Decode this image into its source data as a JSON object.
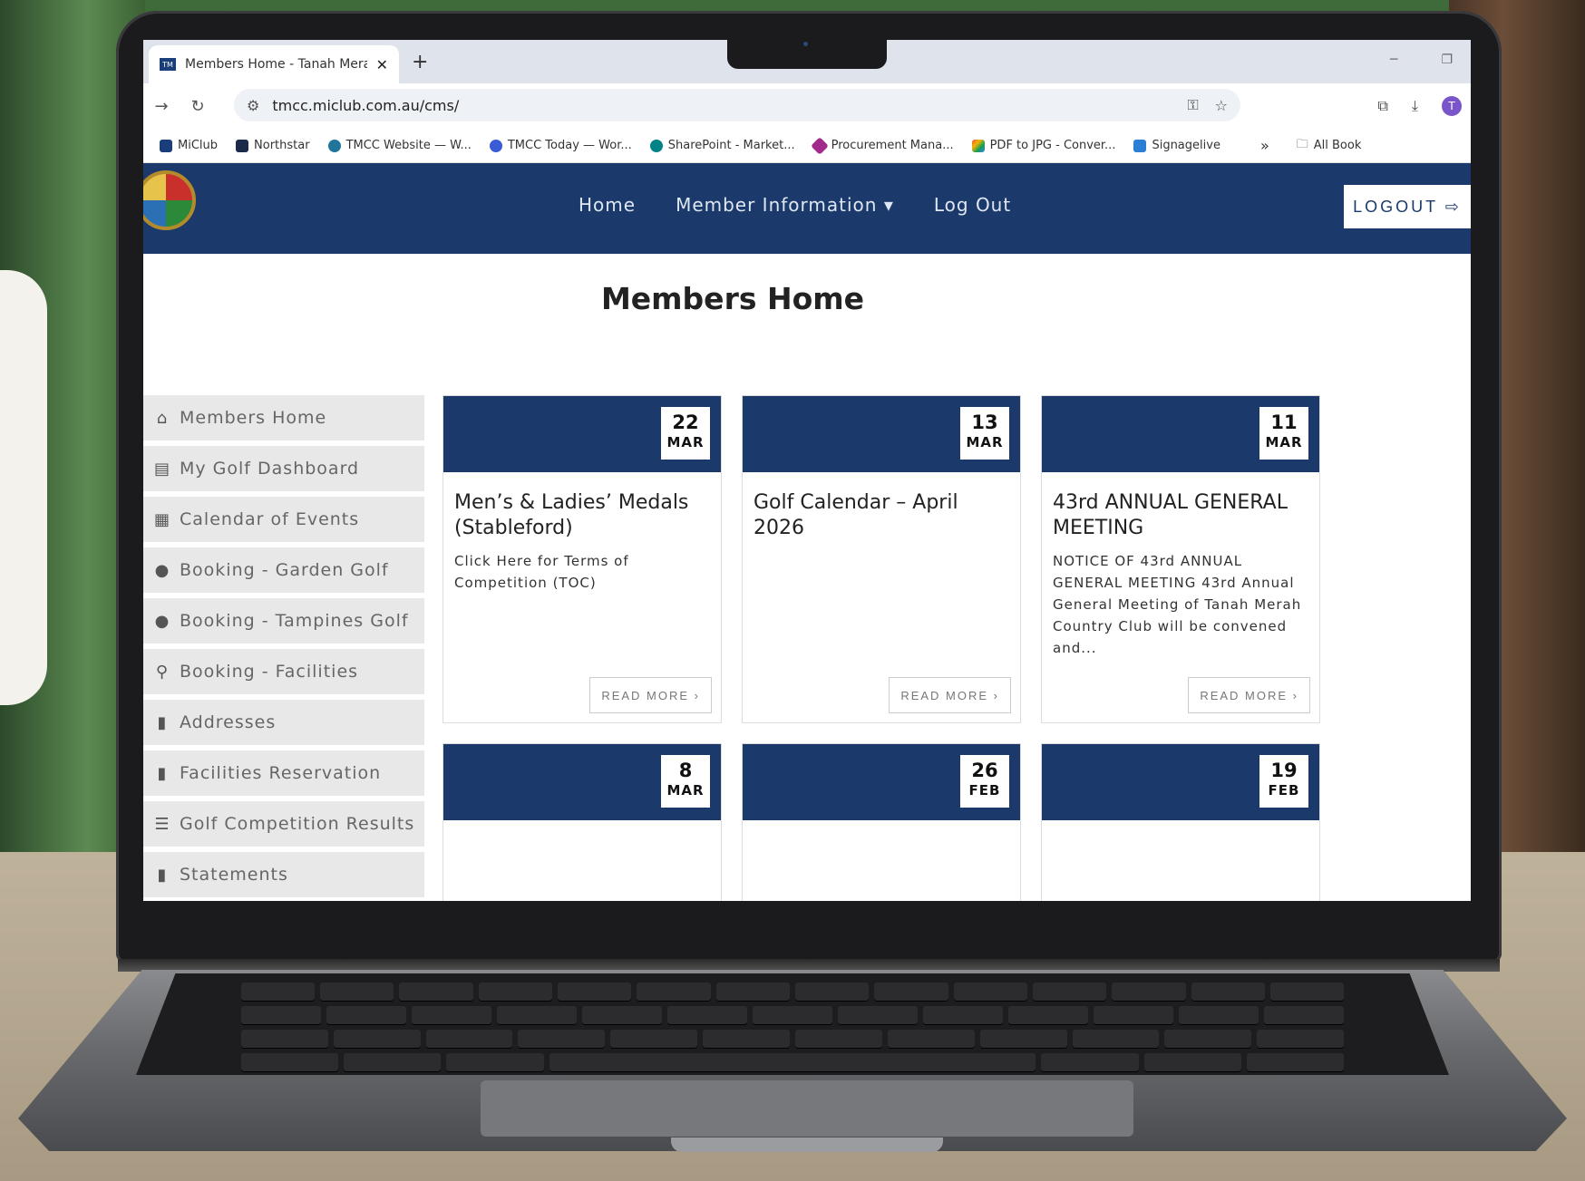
{
  "browser": {
    "tab_title": "Members Home - Tanah Merah",
    "tab_close": "✕",
    "new_tab": "+",
    "url": "tmcc.miclub.com.au/cms/",
    "avatar_letter": "T",
    "bookmarks": [
      {
        "label": "MiClub",
        "color": "#1a3e7a"
      },
      {
        "label": "Northstar",
        "color": "#1c2a4a"
      },
      {
        "label": "TMCC Website — W...",
        "color": "#21759b"
      },
      {
        "label": "TMCC Today — Wor...",
        "color": "#3a5bd6"
      },
      {
        "label": "SharePoint - Market...",
        "color": "#038387"
      },
      {
        "label": "Procurement Mana...",
        "color": "#a12a8a"
      },
      {
        "label": "PDF to JPG - Conver...",
        "color": "#e5533d"
      },
      {
        "label": "Signagelive",
        "color": "#2a7fd4"
      }
    ],
    "bookmarks_overflow": "»",
    "all_bookmarks": "All Book"
  },
  "site": {
    "nav": {
      "home": "Home",
      "member_info": "Member Information ▾",
      "log_out": "Log Out",
      "logout_button": "LOGOUT ⇨"
    },
    "page_title": "Members Home",
    "sidebar": [
      {
        "icon": "⌂",
        "icon_name": "home-icon",
        "label": "Members Home"
      },
      {
        "icon": "▤",
        "icon_name": "dashboard-icon",
        "label": "My Golf Dashboard"
      },
      {
        "icon": "▦",
        "icon_name": "calendar-icon",
        "label": "Calendar of Events"
      },
      {
        "icon": "●",
        "icon_name": "pin-icon",
        "label": "Booking - Garden Golf"
      },
      {
        "icon": "●",
        "icon_name": "pin-icon",
        "label": "Booking - Tampines Golf"
      },
      {
        "icon": "⚲",
        "icon_name": "key-icon",
        "label": "Booking - Facilities"
      },
      {
        "icon": "▮",
        "icon_name": "book-icon",
        "label": "Addresses"
      },
      {
        "icon": "▮",
        "icon_name": "book-icon",
        "label": "Facilities Reservation"
      },
      {
        "icon": "☰",
        "icon_name": "list-icon",
        "label": "Golf Competition Results"
      },
      {
        "icon": "▮",
        "icon_name": "book-icon",
        "label": "Statements"
      }
    ],
    "cards": [
      {
        "day": "22",
        "month": "MAR",
        "title": "Men’s & Ladies’ Medals (Stableford)",
        "body": "Click Here for Terms of Competition (TOC)",
        "button": "READ MORE ›"
      },
      {
        "day": "13",
        "month": "MAR",
        "title": "Golf Calendar – April 2026",
        "body": "",
        "button": "READ MORE ›"
      },
      {
        "day": "11",
        "month": "MAR",
        "title": "43rd ANNUAL GENERAL MEETING",
        "body": "NOTICE OF 43rd ANNUAL GENERAL MEETING 43rd Annual General Meeting of Tanah Merah Country Club will be convened and...",
        "button": "READ MORE ›"
      },
      {
        "day": "8",
        "month": "MAR",
        "title": "",
        "body": "",
        "button": ""
      },
      {
        "day": "26",
        "month": "FEB",
        "title": "",
        "body": "",
        "button": ""
      },
      {
        "day": "19",
        "month": "FEB",
        "title": "",
        "body": "",
        "button": ""
      }
    ]
  },
  "colors": {
    "navy": "#1b3a6b",
    "sidebar_bg": "#e8e8e8"
  }
}
